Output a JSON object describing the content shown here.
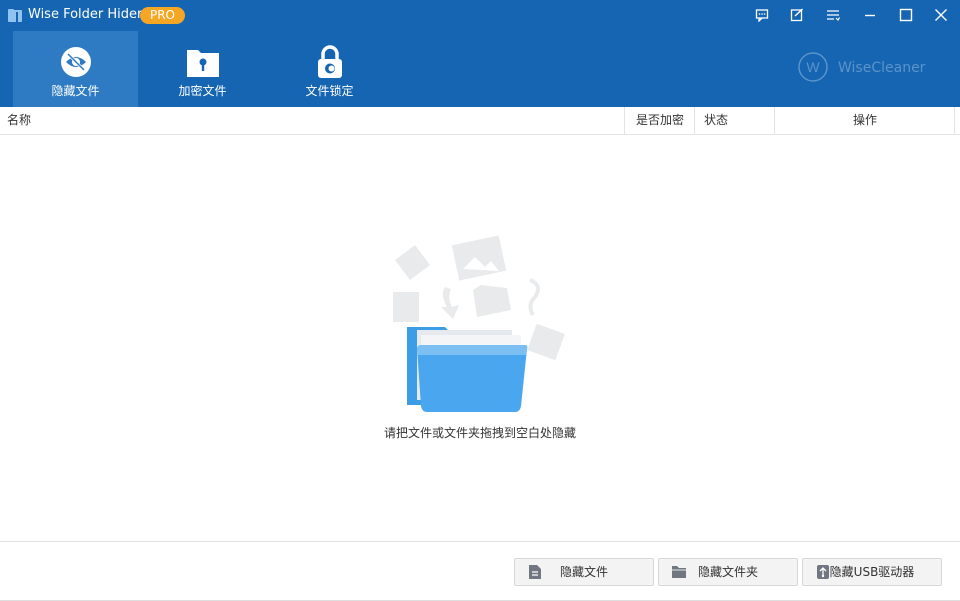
{
  "app": {
    "title": "Wise Folder Hider",
    "badge": "PRO"
  },
  "window_controls": [
    "feedback-icon",
    "edit-icon",
    "menu-icon",
    "minimize-icon",
    "maximize-icon",
    "close-icon"
  ],
  "tabs": [
    {
      "label": "隐藏文件",
      "icon": "eye-slash-icon",
      "active": true
    },
    {
      "label": "加密文件",
      "icon": "folder-lock-icon",
      "active": false
    },
    {
      "label": "文件锁定",
      "icon": "padlock-icon",
      "active": false
    }
  ],
  "brand": {
    "text": "WiseCleaner"
  },
  "table": {
    "columns": [
      "名称",
      "是否加密",
      "状态",
      "操作"
    ]
  },
  "empty_state": {
    "hint": "请把文件或文件夹拖拽到空白处隐藏"
  },
  "footer": {
    "buttons": [
      {
        "label": "隐藏文件",
        "icon": "file-icon"
      },
      {
        "label": "隐藏文件夹",
        "icon": "folder-icon"
      },
      {
        "label": "隐藏USB驱动器",
        "icon": "usb-icon"
      }
    ]
  },
  "colors": {
    "header": "#1565b2",
    "active_tab": "#2e7bc4",
    "badge": "#f5a623",
    "brand": "#5c93c9"
  }
}
